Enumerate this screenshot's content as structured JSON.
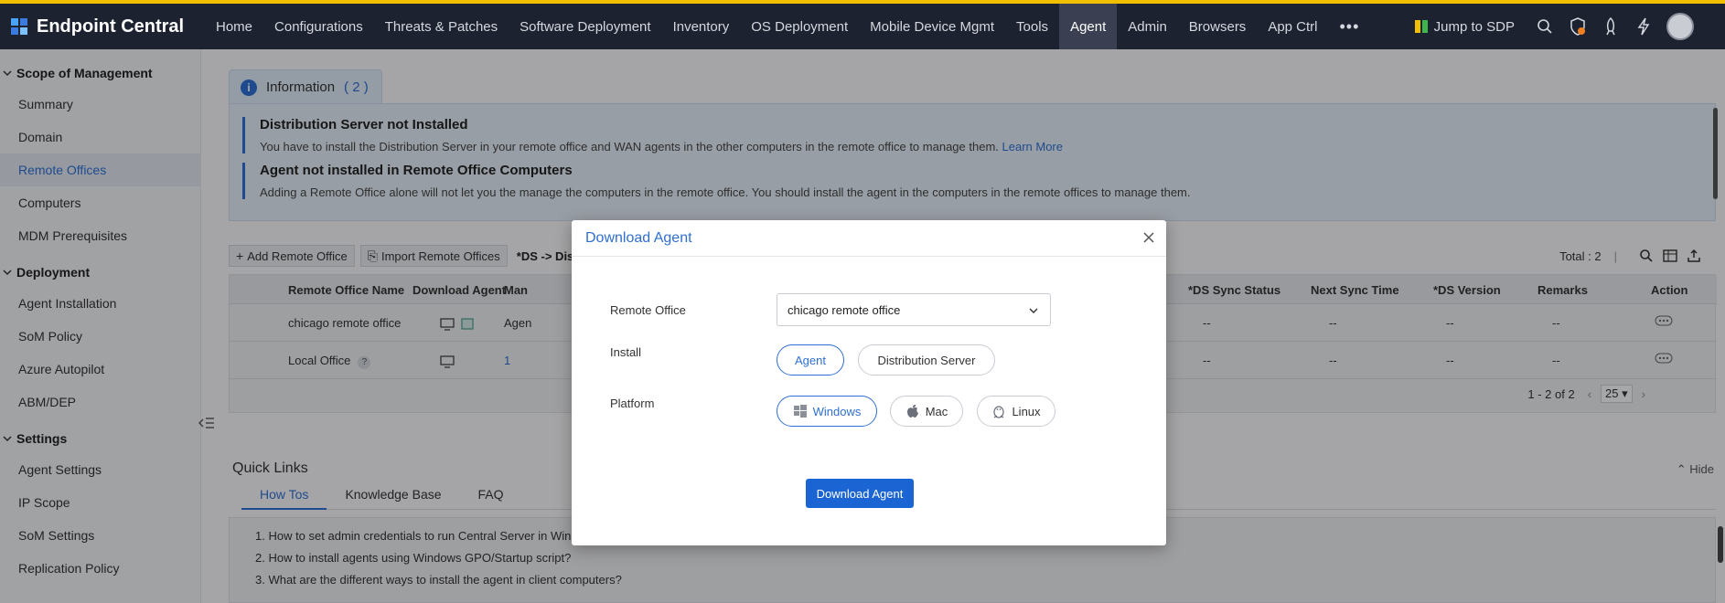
{
  "app": {
    "title": "Endpoint Central"
  },
  "nav": {
    "items": [
      {
        "label": "Home"
      },
      {
        "label": "Configurations"
      },
      {
        "label": "Threats & Patches"
      },
      {
        "label": "Software Deployment"
      },
      {
        "label": "Inventory"
      },
      {
        "label": "OS Deployment"
      },
      {
        "label": "Mobile Device Mgmt"
      },
      {
        "label": "Tools"
      },
      {
        "label": "Agent"
      },
      {
        "label": "Admin"
      },
      {
        "label": "Browsers"
      },
      {
        "label": "App Ctrl"
      }
    ],
    "active": "Agent",
    "more": "•••",
    "jump": "Jump to SDP"
  },
  "sidebar": {
    "sections": [
      {
        "title": "Scope of Management",
        "items": [
          "Summary",
          "Domain",
          "Remote Offices",
          "Computers",
          "MDM Prerequisites"
        ]
      },
      {
        "title": "Deployment",
        "items": [
          "Agent Installation",
          "SoM Policy",
          "Azure Autopilot",
          "ABM/DEP"
        ]
      },
      {
        "title": "Settings",
        "items": [
          "Agent Settings",
          "IP Scope",
          "SoM Settings",
          "Replication Policy"
        ]
      }
    ],
    "active": "Remote Offices"
  },
  "info": {
    "tab_label": "Information",
    "count": "( 2 )",
    "items": [
      {
        "title": "Distribution Server not Installed",
        "text": "You have to install the Distribution Server in your remote office and WAN agents in the other computers in the remote office to manage them.",
        "link": "Learn More"
      },
      {
        "title": "Agent not installed in Remote Office Computers",
        "text": "Adding a Remote Office alone will not let you the manage the computers in the remote office. You should install the agent in the computers in the remote offices to manage them.",
        "link": ""
      }
    ]
  },
  "toolbar": {
    "add": "Add Remote Office",
    "import": "Import Remote Offices",
    "ds": "*DS -> Dis",
    "total": "Total : 2"
  },
  "table": {
    "headers_left": [
      "Remote Office Name",
      "Download Agent",
      "Man"
    ],
    "headers_right": [
      "*DS Sync Status",
      "Next Sync Time",
      "*DS Version",
      "Remarks",
      "Action"
    ],
    "rows": [
      {
        "name": "chicago remote office",
        "managed": "Agen",
        "sync": "--",
        "next": "--",
        "version": "--",
        "remarks": "--",
        "help": ""
      },
      {
        "name": "Local Office",
        "managed": "1",
        "sync": "--",
        "next": "--",
        "version": "--",
        "remarks": "--",
        "help": "?"
      }
    ],
    "pager": {
      "range": "1 - 2 of 2",
      "size": "25"
    }
  },
  "quick_links": {
    "title": "Quick Links",
    "hide": "Hide",
    "tabs": [
      "How Tos",
      "Knowledge Base",
      "FAQ"
    ],
    "active_tab": "How Tos",
    "items": [
      "1. How to set admin credentials to run Central Server in Windows Vista and above?",
      "2. How to install agents using Windows GPO/Startup script?",
      "3. What are the different ways to install the agent in client computers?"
    ]
  },
  "modal": {
    "title": "Download Agent",
    "remote_office_label": "Remote Office",
    "remote_office_value": "chicago remote office",
    "install_label": "Install",
    "install_options": [
      "Agent",
      "Distribution Server"
    ],
    "install_selected": "Agent",
    "platform_label": "Platform",
    "platform_options": [
      "Windows",
      "Mac",
      "Linux"
    ],
    "platform_selected": "Windows",
    "download_button": "Download Agent"
  },
  "colors": {
    "accent": "#2f6fd1",
    "nav_bg": "#1d2230",
    "primary_button": "#1b64d3"
  }
}
